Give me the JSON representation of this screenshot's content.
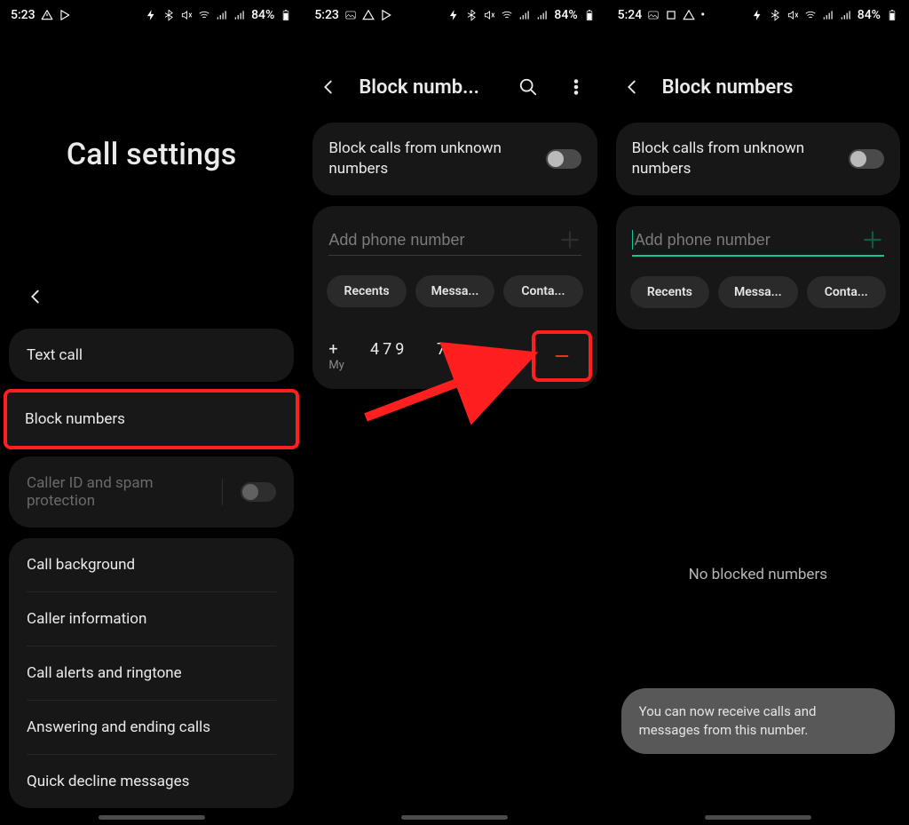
{
  "statusbar": {
    "time_a": "5:23",
    "time_b": "5:23",
    "time_c": "5:24",
    "battery": "84%"
  },
  "screen1": {
    "title": "Call settings",
    "items": {
      "text_call": "Text call",
      "block_numbers": "Block numbers",
      "caller_id_spam": "Caller ID and spam protection",
      "call_background": "Call background",
      "caller_information": "Caller information",
      "call_alerts_ringtone": "Call alerts and ringtone",
      "answering_ending": "Answering and ending calls",
      "quick_decline": "Quick decline messages"
    }
  },
  "screen2": {
    "title": "Block numb...",
    "block_unknown": "Block calls from unknown numbers",
    "add_placeholder": "Add phone number",
    "pills": {
      "recents": "Recents",
      "messages": "Messa...",
      "contacts": "Conta..."
    },
    "entry": {
      "number": "+ 479 7",
      "label": "My"
    }
  },
  "screen3": {
    "title": "Block numbers",
    "block_unknown": "Block calls from unknown numbers",
    "add_placeholder": "Add phone number",
    "pills": {
      "recents": "Recents",
      "messages": "Messa...",
      "contacts": "Conta..."
    },
    "empty": "No blocked numbers",
    "toast": "You can now receive calls and messages from this number."
  }
}
